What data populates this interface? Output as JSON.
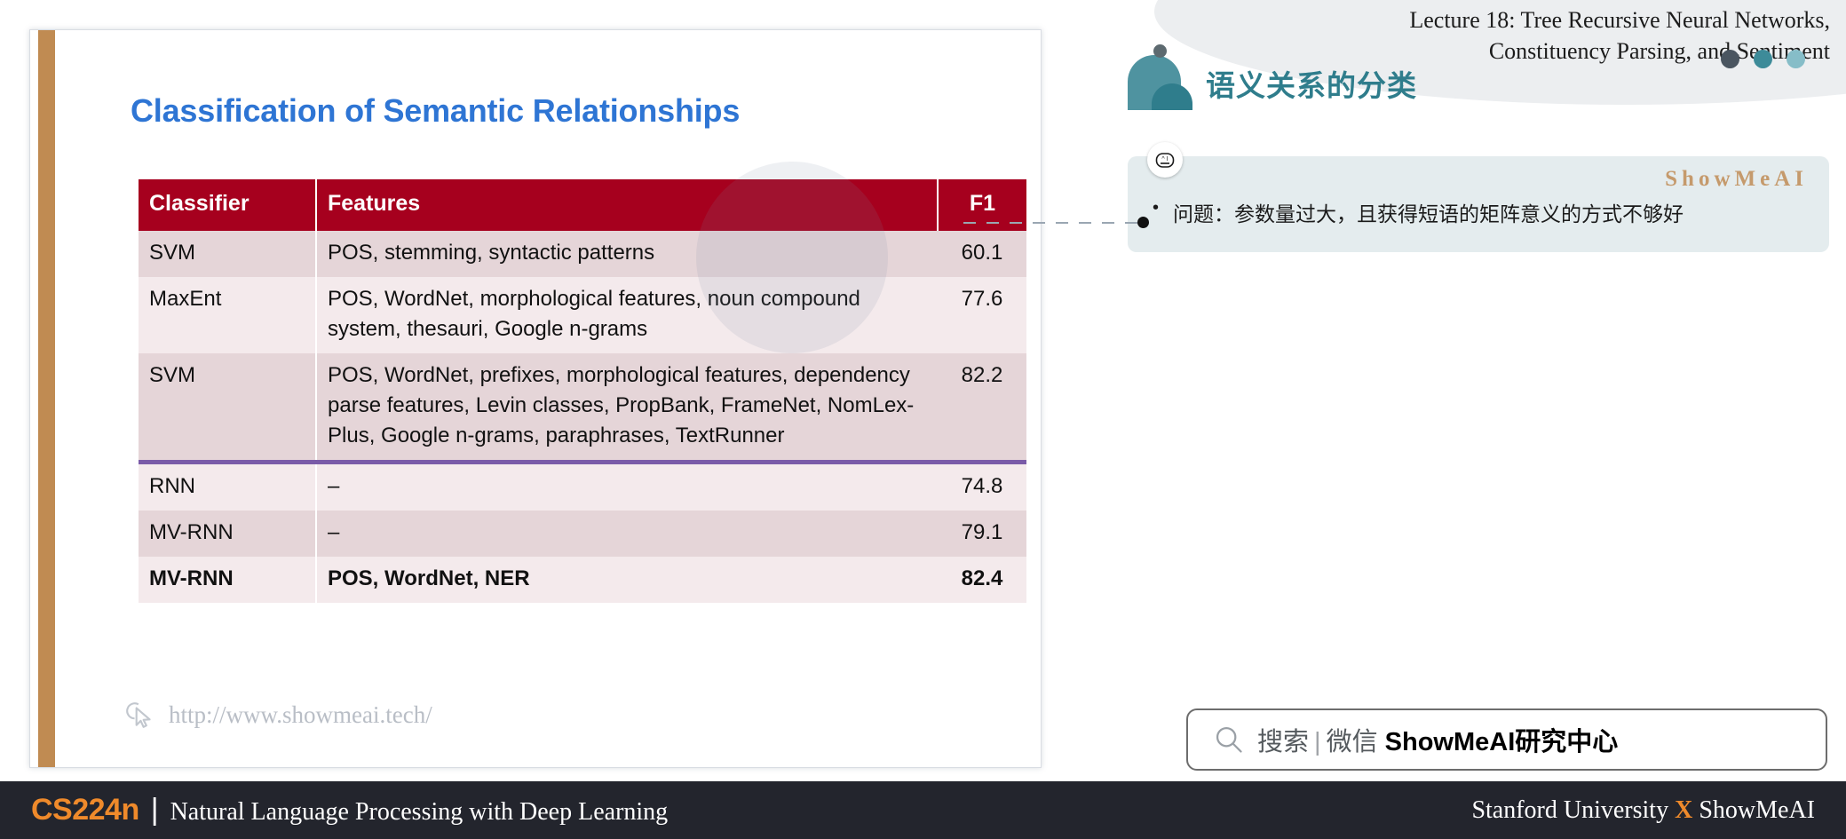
{
  "slide": {
    "title": "Classification of Semantic Relationships",
    "watermark_url": "http://www.showmeai.tech/",
    "cursor_icon": "cursor-arrow-icon",
    "table": {
      "headers": [
        "Classifier",
        "Features",
        "F1"
      ],
      "rows": [
        {
          "classifier": "SVM",
          "features": "POS, stemming, syntactic patterns",
          "f1": "60.1",
          "bold": false
        },
        {
          "classifier": "MaxEnt",
          "features": "POS, WordNet, morphological features, noun compound system, thesauri, Google n-grams",
          "f1": "77.6",
          "bold": false
        },
        {
          "classifier": "SVM",
          "features": "POS, WordNet, prefixes, morphological features, dependency parse features, Levin classes, PropBank, FrameNet, NomLex-Plus, Google n-grams, paraphrases, TextRunner",
          "f1": "82.2",
          "bold": false
        },
        {
          "classifier": "RNN",
          "features": "–",
          "f1": "74.8",
          "bold": false
        },
        {
          "classifier": "MV-RNN",
          "features": "–",
          "f1": "79.1",
          "bold": false
        },
        {
          "classifier": "MV-RNN",
          "features": "POS, WordNet, NER",
          "f1": "82.4",
          "bold": true
        }
      ]
    }
  },
  "right": {
    "lecture_title_line1": "Lecture 18: Tree Recursive Neural Networks,",
    "lecture_title_line2": "Constituency Parsing, and Sentiment",
    "cn_heading": "语义关系的分类",
    "note": {
      "brand": "ShowMeAI",
      "bullet_marker": "•",
      "bullet_text": "问题：参数量过大，且获得短语的矩阵意义的方式不够好",
      "bot_icon": "robot-face-icon"
    },
    "search": {
      "icon": "search-icon",
      "label": "搜索",
      "divider": "|",
      "channel": "微信",
      "brand": "ShowMeAI研究中心"
    }
  },
  "footer": {
    "course": "CS224n",
    "separator": "|",
    "subtitle": "Natural Language Processing with Deep Learning",
    "right_prefix": "Stanford University ",
    "right_x": "X",
    "right_suffix": " ShowMeAI"
  },
  "colors": {
    "title_blue": "#2e75d4",
    "table_header_red": "#a6001e",
    "band_dark": "#e5d5d8",
    "band_light": "#f4eaec",
    "divider_purple": "#7a5ba8",
    "teal": "#2f7d8c",
    "accent_orange": "#ef8a2b",
    "sidebar_tan": "#c08b52",
    "note_bg": "#e4ecee",
    "footer_bg": "#23252d"
  }
}
